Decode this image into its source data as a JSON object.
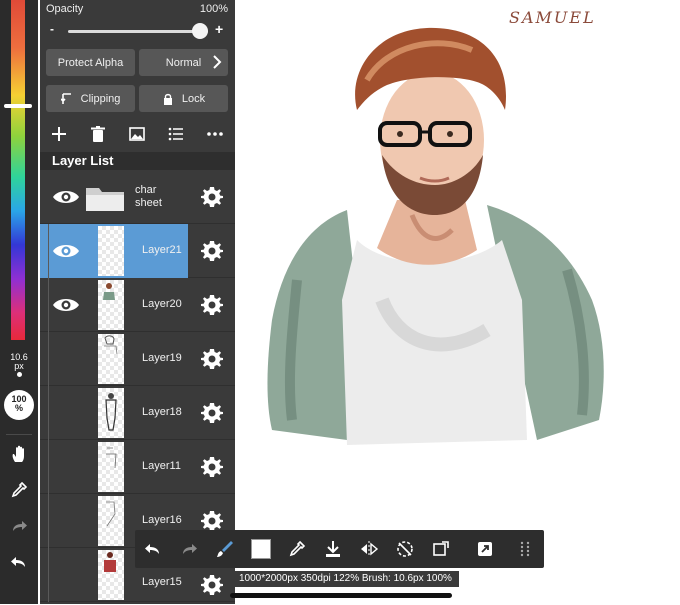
{
  "panel": {
    "opacity_label": "Opacity",
    "opacity_value": "100%",
    "slider_minus": "-",
    "slider_plus": "+",
    "opacity_fraction": 1.0,
    "protect_alpha": "Protect Alpha",
    "blend_mode": "Normal",
    "clipping": "Clipping",
    "lock": "Lock",
    "layer_list_title": "Layer List"
  },
  "layers": [
    {
      "name": "char\nsheet",
      "type": "folder",
      "visible": true,
      "selected": false
    },
    {
      "name": "Layer21",
      "type": "layer",
      "visible": true,
      "selected": true
    },
    {
      "name": "Layer20",
      "type": "layer",
      "visible": true,
      "selected": false
    },
    {
      "name": "Layer19",
      "type": "layer",
      "visible": false,
      "selected": false
    },
    {
      "name": "Layer18",
      "type": "layer",
      "visible": false,
      "selected": false
    },
    {
      "name": "Layer11",
      "type": "layer",
      "visible": false,
      "selected": false
    },
    {
      "name": "Layer16",
      "type": "layer",
      "visible": false,
      "selected": false
    },
    {
      "name": "Layer15",
      "type": "layer",
      "visible": false,
      "selected": false
    }
  ],
  "toolstrip": {
    "brush_size": "10.6",
    "brush_unit": "px",
    "brush_opacity": "100",
    "brush_opacity_unit": "%"
  },
  "canvas": {
    "signature": "SAMUEL"
  },
  "status_bar": "1000*2000px 350dpi 122% Brush: 10.6px 100%",
  "colors": {
    "panel_bg": "#3a3a3a",
    "selected_layer": "#5b9bd5",
    "toolbar_bg": "#2d2d2d",
    "signature": "#8b4a3a"
  }
}
